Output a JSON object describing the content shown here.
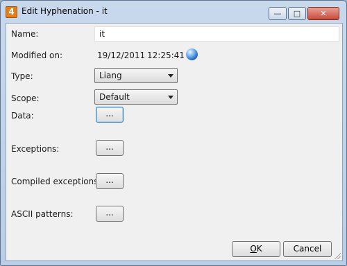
{
  "window": {
    "title": "Edit Hyphenation - it",
    "app_icon_text": "4"
  },
  "fields": {
    "name": {
      "label": "Name:",
      "value": "it"
    },
    "modified": {
      "label": "Modified on:",
      "date": "19/12/2011",
      "time": "12:25:41"
    },
    "type": {
      "label": "Type:",
      "value": "Liang"
    },
    "scope": {
      "label": "Scope:",
      "value": "Default"
    },
    "data": {
      "label": "Data:",
      "button": "..."
    },
    "exceptions": {
      "label": "Exceptions:",
      "button": "..."
    },
    "compiled_exceptions": {
      "label": "Compiled exceptions:",
      "button": "..."
    },
    "ascii_patterns": {
      "label": "ASCII patterns:",
      "button": "..."
    }
  },
  "buttons": {
    "ok_prefix": "",
    "ok_mnemonic": "O",
    "ok_rest": "K",
    "cancel": "Cancel"
  },
  "icons": {
    "globe": "globe-icon"
  }
}
